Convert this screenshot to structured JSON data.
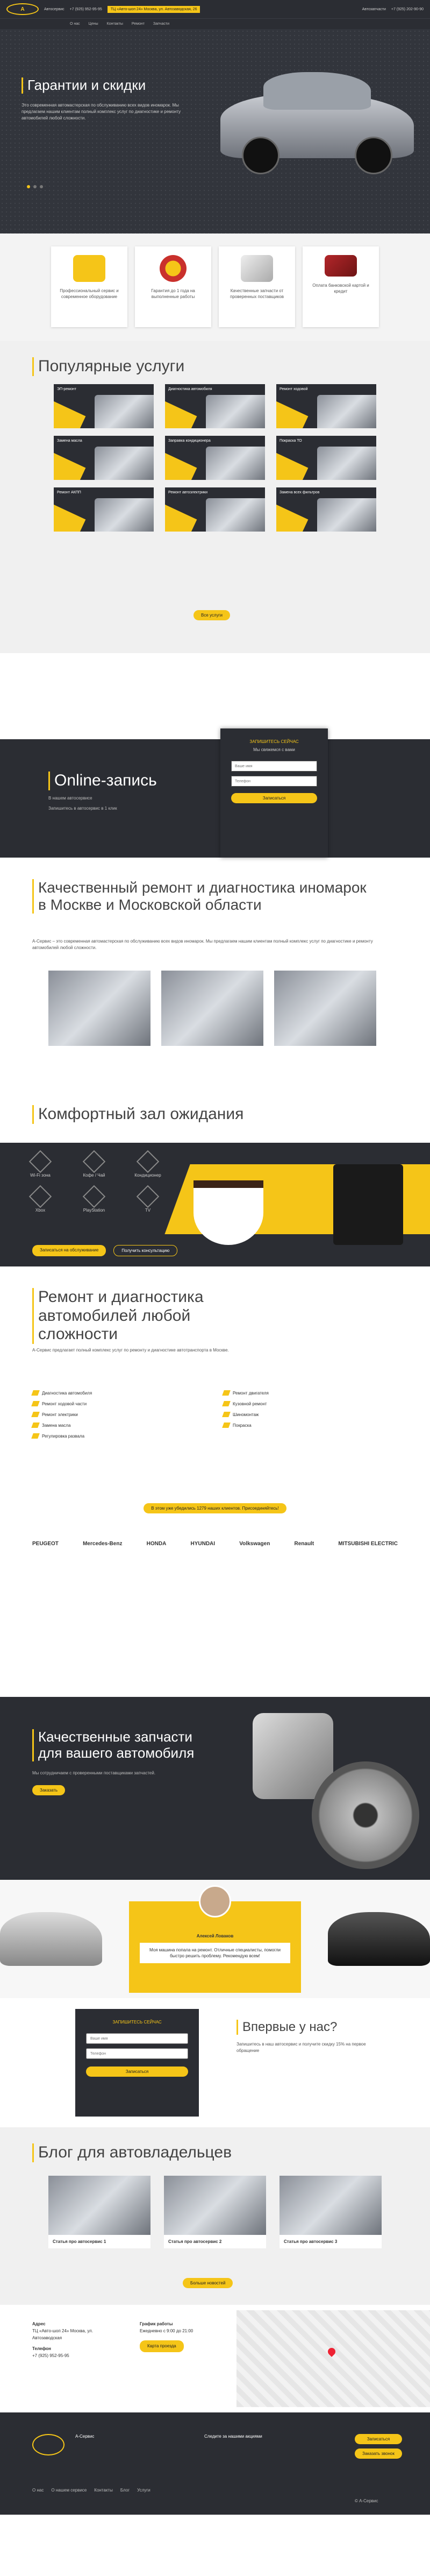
{
  "header": {
    "service_label": "Автосервис",
    "phone_1": "+7 (925) 952-95-95",
    "phone_2": "+7 (925) 202-90-90",
    "address": "ТЦ «Авто-шоп 24» Москва, ул. Автозаводская, 26",
    "sale_label": "Автозапчасти",
    "sale_phone": "+7 (925) 202-90-90",
    "nav": [
      "О нас",
      "Цены",
      "Контакты",
      "Ремонт",
      "Запчасти"
    ]
  },
  "hero": {
    "title": "Гарантии и скидки",
    "text": "Это современная автомастерская по обслуживанию всех видов иномарок. Мы предлагаем нашим клиентам полный комплекс услуг по диагностике и ремонту автомобилей любой сложности."
  },
  "features": [
    {
      "text": "Профессиональный сервис и современное оборудование"
    },
    {
      "text": "Гарантия до 1 года на выполненные работы"
    },
    {
      "text": "Качественные запчасти от проверенных поставщиков"
    },
    {
      "text": "Оплата банковской картой и кредит"
    }
  ],
  "services": {
    "title": "Популярные услуги",
    "items": [
      "ЭП-ремонт",
      "Диагностика автомобиля",
      "Ремонт ходовой",
      "Замена масла",
      "Заправка кондиционера",
      "Покраска ТО",
      "Ремонт АКПП",
      "Ремонт автоэлектрики",
      "Замена всех фильтров"
    ],
    "button": "Все услуги"
  },
  "online": {
    "title": "Online-запись",
    "line1": "В нашем автосервисе",
    "line2": "Запишитесь в автосервис в 1 клик",
    "form_title": "ЗАПИШИТЕСЬ СЕЙЧАС",
    "form_sub": "Мы свяжемся с вами",
    "name_ph": "Ваше имя",
    "phone_ph": "Телефон",
    "submit": "Записаться"
  },
  "quality": {
    "title": "Качественный ремонт и диагностика иномарок в Москве и Московской области",
    "text": "А-Сервис – это современная автомастерская по обслуживанию всех видов иномарок. Мы предлагаем нашим клиентам полный комплекс услуг по диагностике и ремонту автомобилей любой сложности."
  },
  "wait": {
    "title": "Комфортный зал ожидания",
    "items": [
      "Wi-Fi зона",
      "Кофе / Чай",
      "Кондиционер",
      "Xbox",
      "PlayStation",
      "TV"
    ],
    "btn1": "Записаться на обслуживание",
    "btn2": "Получить консультацию"
  },
  "repair": {
    "title": "Ремонт и диагностика автомобилей любой сложности",
    "text": "А-Сервис предлагает полный комплекс услуг по ремонту и диагностике автотранспорта в Москве.",
    "list": [
      "Диагностика автомобиля",
      "Ремонт двигателя",
      "Ремонт ходовой части",
      "Кузовной ремонт",
      "Ремонт электрики",
      "Шиномонтаж",
      "Замена масла",
      "Покраска",
      "Регулировка развала"
    ],
    "cta": "В этом уже убедились 1279 наших клиентов. Присоединяйтесь!",
    "brands": [
      "PEUGEOT",
      "Mercedes-Benz",
      "HONDA",
      "HYUNDAI",
      "Volkswagen",
      "Renault",
      "MITSUBISHI ELECTRIC"
    ]
  },
  "parts": {
    "title": "Качественные запчасти для вашего автомобиля",
    "text": "Мы сотрудничаем с проверенными поставщиками запчастей.",
    "button": "Заказать"
  },
  "review": {
    "name": "Алексей Ловаков",
    "text": "Моя машина попала на ремонт. Отличные специалисты, помогли быстро решить проблему. Рекомендую всем!"
  },
  "callback": {
    "title": "ЗАПИШИТЕСЬ СЕЙЧАС",
    "submit": "Записаться",
    "first_title": "Впервые у нас?",
    "first_text": "Запишитесь в наш автосервис и получите скидку 15% на первое обращение"
  },
  "blog": {
    "title": "Блог для автовладельцев",
    "posts": [
      "Статья про автосервис 1",
      "Статья про автосервис 2",
      "Статья про автосервис 3"
    ],
    "button": "Больше новостей"
  },
  "contacts": {
    "addr_label": "Адрес",
    "addr": "ТЦ «Авто-шоп 24» Москва, ул. Автозаводская",
    "phone_label": "Телефон",
    "phone": "+7 (925) 952-95-95",
    "hours_label": "График работы",
    "hours": "Ежедневно с 9:00 до 21:00",
    "map_button": "Карта проезда"
  },
  "footer": {
    "brand": "А-Сервис",
    "links": [
      "О нас",
      "О нашем сервисе",
      "Контакты",
      "Блог",
      "Услуги"
    ],
    "email_label": "Следите за нашими акциями",
    "button1": "Записаться",
    "button2": "Заказать звонок",
    "copy": "© А-Сервис"
  }
}
